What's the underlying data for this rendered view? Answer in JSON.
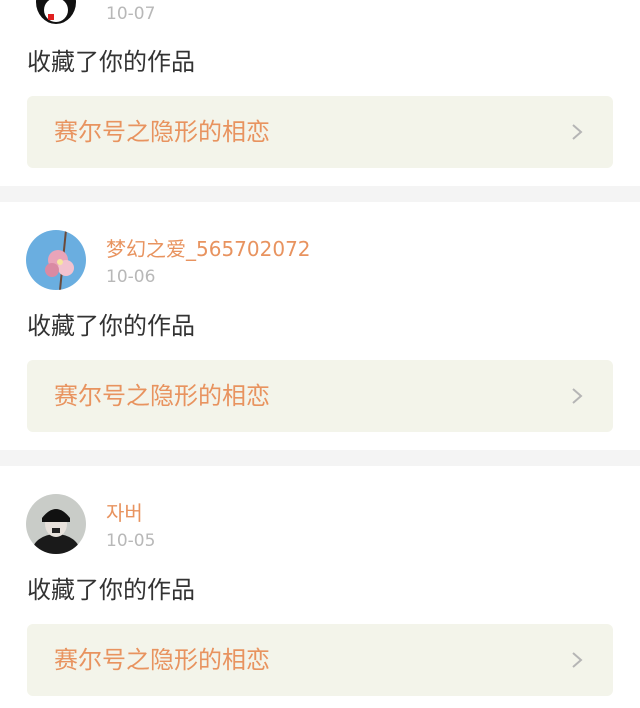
{
  "items": [
    {
      "username": "",
      "date": "10-07",
      "action": "收藏了你的作品",
      "work_title": "赛尔号之隐形的相恋",
      "avatar": "penguin-avatar"
    },
    {
      "username": "梦幻之爱_565702072",
      "date": "10-06",
      "action": "收藏了你的作品",
      "work_title": "赛尔号之隐形的相恋",
      "avatar": "flower-avatar"
    },
    {
      "username": "자버",
      "date": "10-05",
      "action": "收藏了你的作品",
      "work_title": "赛尔号之隐形的相恋",
      "avatar": "person-cap-avatar"
    }
  ],
  "icons": {
    "chevron": "chevron-right-icon"
  },
  "colors": {
    "accent": "#e8935f",
    "card_bg": "#f3f4ea",
    "separator": "#f4f4f4"
  }
}
